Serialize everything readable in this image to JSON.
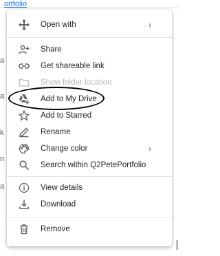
{
  "background": {
    "link_text": "ortfolio",
    "edge_chars": [
      "a",
      "a",
      "k",
      "n",
      "a"
    ]
  },
  "menu": {
    "items": [
      {
        "label": "Open with",
        "icon": "move-arrows-icon",
        "submenu": true,
        "enabled": true
      },
      {
        "label": "Share",
        "icon": "person-add-icon",
        "submenu": false,
        "enabled": true
      },
      {
        "label": "Get shareable link",
        "icon": "link-icon",
        "submenu": false,
        "enabled": true
      },
      {
        "label": "Show folder location",
        "icon": "folder-icon",
        "submenu": false,
        "enabled": false
      },
      {
        "label": "Add to My Drive",
        "icon": "drive-add-icon",
        "submenu": false,
        "enabled": true,
        "highlighted": true
      },
      {
        "label": "Add to Starred",
        "icon": "star-icon",
        "submenu": false,
        "enabled": true
      },
      {
        "label": "Rename",
        "icon": "pencil-icon",
        "submenu": false,
        "enabled": true
      },
      {
        "label": "Change color",
        "icon": "palette-icon",
        "submenu": true,
        "enabled": true
      },
      {
        "label": "Search within Q2PetePortfolio",
        "icon": "search-icon",
        "submenu": false,
        "enabled": true
      },
      {
        "label": "View details",
        "icon": "info-icon",
        "submenu": false,
        "enabled": true
      },
      {
        "label": "Download",
        "icon": "download-icon",
        "submenu": false,
        "enabled": true
      },
      {
        "label": "Remove",
        "icon": "trash-icon",
        "submenu": false,
        "enabled": true
      }
    ],
    "chevron": "›"
  },
  "colors": {
    "icon": "#5f6368",
    "text": "#202124",
    "disabled": "#b5b5b5",
    "annotation": "#000000"
  }
}
